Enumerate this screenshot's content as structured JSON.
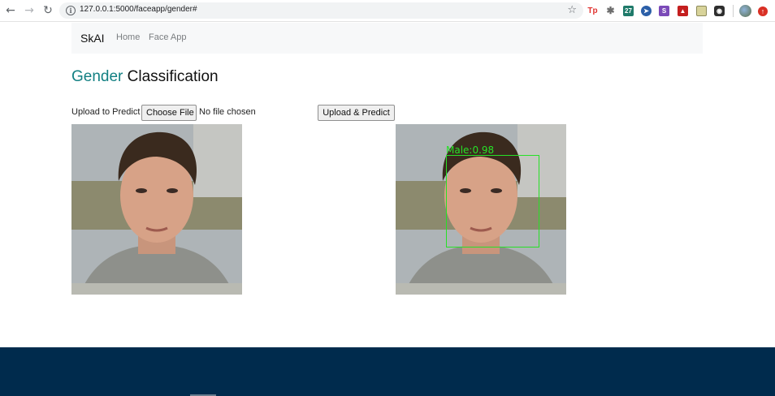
{
  "browser": {
    "url": "127.0.0.1:5000/faceapp/gender#",
    "extensions": [
      {
        "name": "tp-extension-icon",
        "text": "Tp",
        "color": "#e0322f"
      },
      {
        "name": "puzzle-extension-icon",
        "text": "",
        "color": "#6d6d6d"
      },
      {
        "name": "calendar-extension-icon",
        "text": "27",
        "color": "#1f7a6a"
      },
      {
        "name": "compass-extension-icon",
        "text": "",
        "color": "#2b5fa8"
      },
      {
        "name": "s-extension-icon",
        "text": "S",
        "color": "#7b4ab8"
      },
      {
        "name": "pdf-extension-icon",
        "text": "",
        "color": "#c41f1f"
      },
      {
        "name": "notes-extension-icon",
        "text": "",
        "color": "#b7b37a"
      },
      {
        "name": "camera-extension-icon",
        "text": "",
        "color": "#2e2e2e"
      }
    ]
  },
  "navbar": {
    "brand": "SkAI",
    "links": [
      "Home",
      "Face App"
    ]
  },
  "page": {
    "title_accent": "Gender",
    "title_rest": " Classification"
  },
  "form": {
    "upload_label": "Upload to Predict",
    "file_button": "Choose File",
    "file_status": "No file chosen",
    "submit_button": "Upload & Predict"
  },
  "result": {
    "label": "Male:0.98",
    "box_color": "#27e027"
  },
  "colors": {
    "accent": "#138083",
    "footer": "#002b4d"
  }
}
